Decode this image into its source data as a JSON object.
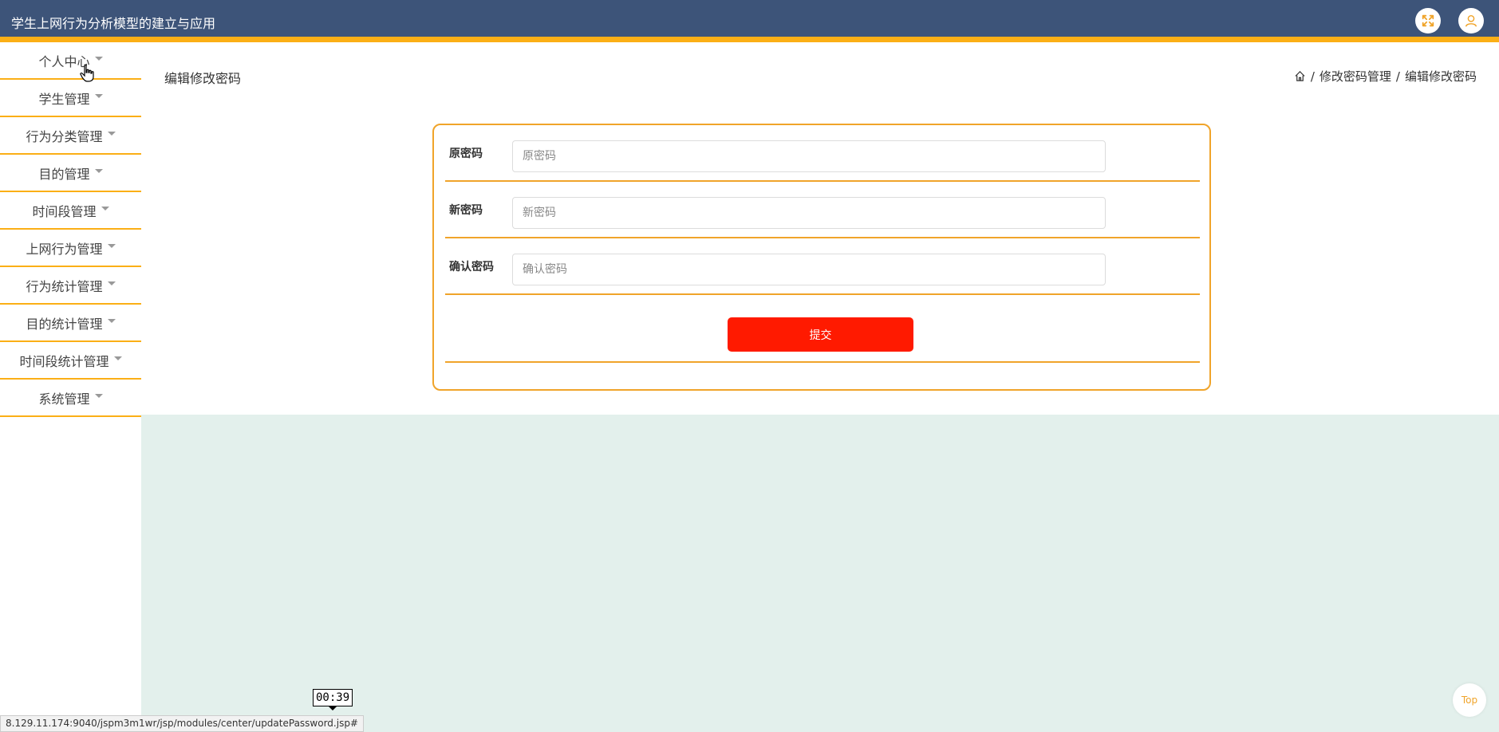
{
  "header": {
    "title": "学生上网行为分析模型的建立与应用",
    "icons": [
      "fullscreen-icon",
      "user-icon"
    ],
    "accent_color": "#fbaf16",
    "background_color": "#3d5479"
  },
  "sidebar": {
    "items": [
      {
        "label": "个人中心"
      },
      {
        "label": "学生管理"
      },
      {
        "label": "行为分类管理"
      },
      {
        "label": "目的管理"
      },
      {
        "label": "时间段管理"
      },
      {
        "label": "上网行为管理"
      },
      {
        "label": "行为统计管理"
      },
      {
        "label": "目的统计管理"
      },
      {
        "label": "时间段统计管理"
      },
      {
        "label": "系统管理"
      }
    ]
  },
  "main": {
    "page_title": "编辑修改密码",
    "breadcrumb": {
      "home_icon": "home-icon",
      "items": [
        "修改密码管理",
        "编辑修改密码"
      ],
      "separator": "/"
    },
    "form": {
      "fields": [
        {
          "label": "原密码",
          "placeholder": "原密码",
          "value": ""
        },
        {
          "label": "新密码",
          "placeholder": "新密码",
          "value": ""
        },
        {
          "label": "确认密码",
          "placeholder": "确认密码",
          "value": ""
        }
      ],
      "submit_label": "提交",
      "border_color": "#f0a42a",
      "button_color": "#ff1a00"
    }
  },
  "overlay": {
    "timer": "00:39",
    "status_url": "8.129.11.174:9040/jspm3m1wr/jsp/modules/center/updatePassword.jsp#",
    "top_button_label": "Top"
  }
}
